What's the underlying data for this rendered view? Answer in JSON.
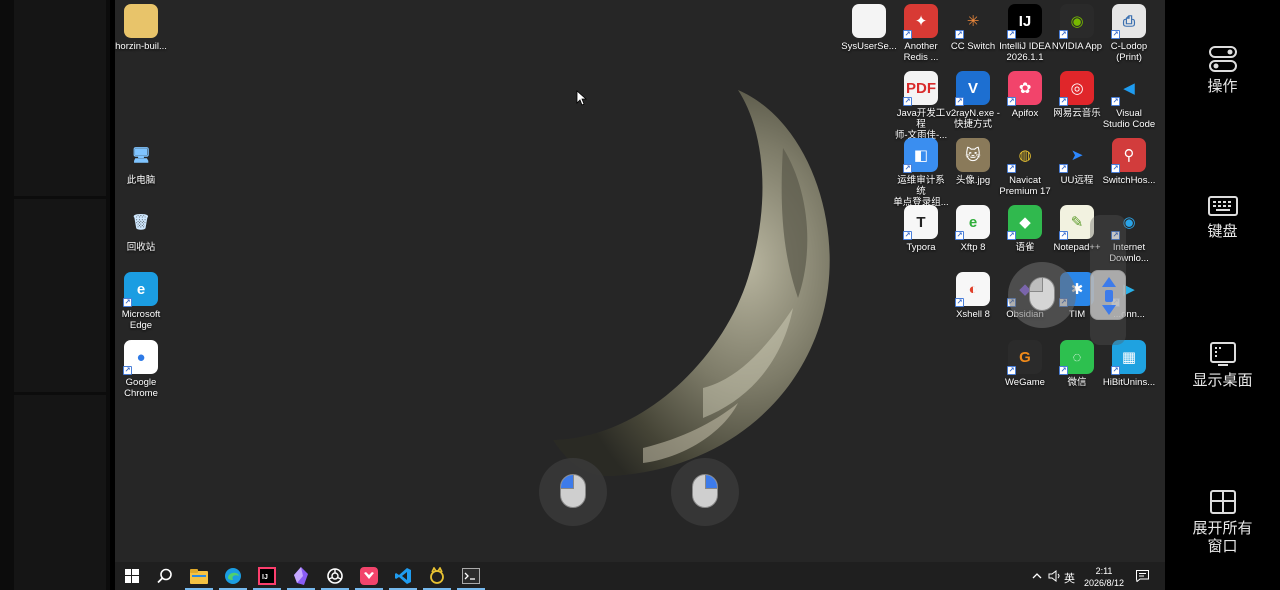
{
  "desktop_left": [
    {
      "label": "horzin-buil...",
      "icon": "folder-zip-icon"
    },
    {
      "label": "此电脑",
      "icon": "this-pc-icon"
    },
    {
      "label": "回收站",
      "icon": "recycle-bin-icon"
    },
    {
      "label": "Microsoft\nEdge",
      "icon": "edge-icon"
    },
    {
      "label": "Google\nChrome",
      "icon": "chrome-icon"
    }
  ],
  "desktop_right": [
    {
      "label": "SysUserSe...",
      "icon": "file-icon"
    },
    {
      "label": "Another\nRedis ...",
      "icon": "another-redis-icon"
    },
    {
      "label": "CC Switch",
      "icon": "cc-switch-icon"
    },
    {
      "label": "IntelliJ IDEA\n2026.1.1",
      "icon": "intellij-icon"
    },
    {
      "label": "NVIDIA App",
      "icon": "nvidia-icon"
    },
    {
      "label": "C-Lodop\n(Print)",
      "icon": "printer-icon"
    },
    {
      "label": "Java开发工程\n师-文雨佳-...",
      "icon": "pdf-icon"
    },
    {
      "label": "v2rayN.exe -\n快捷方式",
      "icon": "v2rayn-icon"
    },
    {
      "label": "Apifox",
      "icon": "apifox-icon"
    },
    {
      "label": "网易云音乐",
      "icon": "netease-music-icon"
    },
    {
      "label": "Visual\nStudio Code",
      "icon": "vscode-icon"
    },
    {
      "label": "运维审计系统\n单点登录组...",
      "icon": "audit-icon"
    },
    {
      "label": "头像.jpg",
      "icon": "cat-image-icon"
    },
    {
      "label": "Navicat\nPremium 17",
      "icon": "navicat-icon"
    },
    {
      "label": "UU远程",
      "icon": "uu-remote-icon"
    },
    {
      "label": "SwitchHos...",
      "icon": "switchhosts-icon"
    },
    {
      "label": "Typora",
      "icon": "typora-icon"
    },
    {
      "label": "Xftp 8",
      "icon": "xftp-icon"
    },
    {
      "label": "语雀",
      "icon": "yuque-icon"
    },
    {
      "label": "Notepad++",
      "icon": "notepadpp-icon"
    },
    {
      "label": "Internet\nDownlo...",
      "icon": "idm-icon"
    },
    {
      "label": "Xshell 8",
      "icon": "xshell-icon"
    },
    {
      "label": "Obsidian",
      "icon": "obsidian-icon"
    },
    {
      "label": "TIM",
      "icon": "tim-icon"
    },
    {
      "label": "...onn...",
      "icon": "connect-icon"
    },
    {
      "label": "WeGame",
      "icon": "wegame-icon"
    },
    {
      "label": "微信",
      "icon": "wechat-icon"
    },
    {
      "label": "HiBitUnins...",
      "icon": "hibit-icon"
    }
  ],
  "taskbar": {
    "apps": [
      "start-icon",
      "search-icon",
      "file-explorer-icon",
      "edge-icon",
      "intellij-icon",
      "obsidian-icon",
      "chatgpt-icon",
      "apifox-icon",
      "vscode-icon",
      "navicat-icon",
      "terminal-icon"
    ],
    "ime": "英",
    "time": "2:11",
    "date": "2026/8/12"
  },
  "side_panel": [
    {
      "label": "操作",
      "icon": "toggle-icon"
    },
    {
      "label": "键盘",
      "icon": "keyboard-icon"
    },
    {
      "label": "显示桌面",
      "icon": "show-desktop-icon"
    },
    {
      "label": "展开所有\n窗口",
      "icon": "expand-windows-icon"
    }
  ]
}
